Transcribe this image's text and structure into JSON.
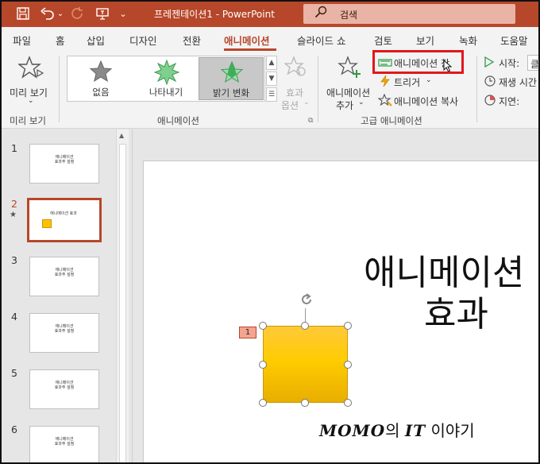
{
  "app": {
    "title": "프레젠테이션1  -  PowerPoint",
    "search_placeholder": "검색",
    "accent": "#b7472a"
  },
  "quick_access": [
    {
      "name": "save-icon",
      "glyph": "🖫"
    },
    {
      "name": "undo-icon",
      "glyph": "↶"
    },
    {
      "name": "undo-dropdown-icon",
      "glyph": "⌄"
    },
    {
      "name": "redo-icon",
      "glyph": "↻"
    },
    {
      "name": "present-icon",
      "glyph": "⊡"
    },
    {
      "name": "customize-icon",
      "glyph": "⌄"
    }
  ],
  "tabs": [
    "파일",
    "홈",
    "삽입",
    "디자인",
    "전환",
    "애니메이션",
    "슬라이드 쇼",
    "검토",
    "보기",
    "녹화",
    "도움말"
  ],
  "active_tab": "애니메이션",
  "ribbon": {
    "preview": {
      "label": "미리 보기",
      "group": "미리 보기"
    },
    "animation": {
      "group": "애니메이션",
      "gallery": [
        {
          "label": "없음",
          "icon": "star-gray-icon"
        },
        {
          "label": "나타내기",
          "icon": "star-burst-green-icon"
        },
        {
          "label": "밝기 변화",
          "icon": "star-fade-green-icon",
          "selected": true
        }
      ],
      "effect_options_line1": "효과",
      "effect_options_line2": "옵션"
    },
    "advanced": {
      "group": "고급 애니메이션",
      "add_animation_line1": "애니메이션",
      "add_animation_line2": "추가",
      "animation_pane": "애니메이션 창",
      "trigger": "트리거",
      "painter": "애니메이션 복사"
    },
    "timing": {
      "start": "시작:",
      "start_value": "클",
      "duration": "재생 시간",
      "delay": "지연:"
    }
  },
  "slides": [
    {
      "num": "1",
      "text": "애니메이션\n효과주 설정"
    },
    {
      "num": "2",
      "text": "애니메이션\n효과",
      "selected": true,
      "has_animation": true
    },
    {
      "num": "3",
      "text": "애니메이션\n효과주 설정"
    },
    {
      "num": "4",
      "text": "애니메이션\n효과주 설정"
    },
    {
      "num": "5",
      "text": "애니메이션\n효과주 설정"
    },
    {
      "num": "6",
      "text": "애니메이션\n효과주 설정"
    }
  ],
  "slide_canvas": {
    "title_line1": "애니메이션",
    "title_line2": "효과",
    "animation_order_tag": "1",
    "shape_fill": "#ffcc00"
  },
  "watermark": {
    "brand": "MOMO",
    "mid": "의 ",
    "it": "IT",
    "tail": " 이야기"
  }
}
